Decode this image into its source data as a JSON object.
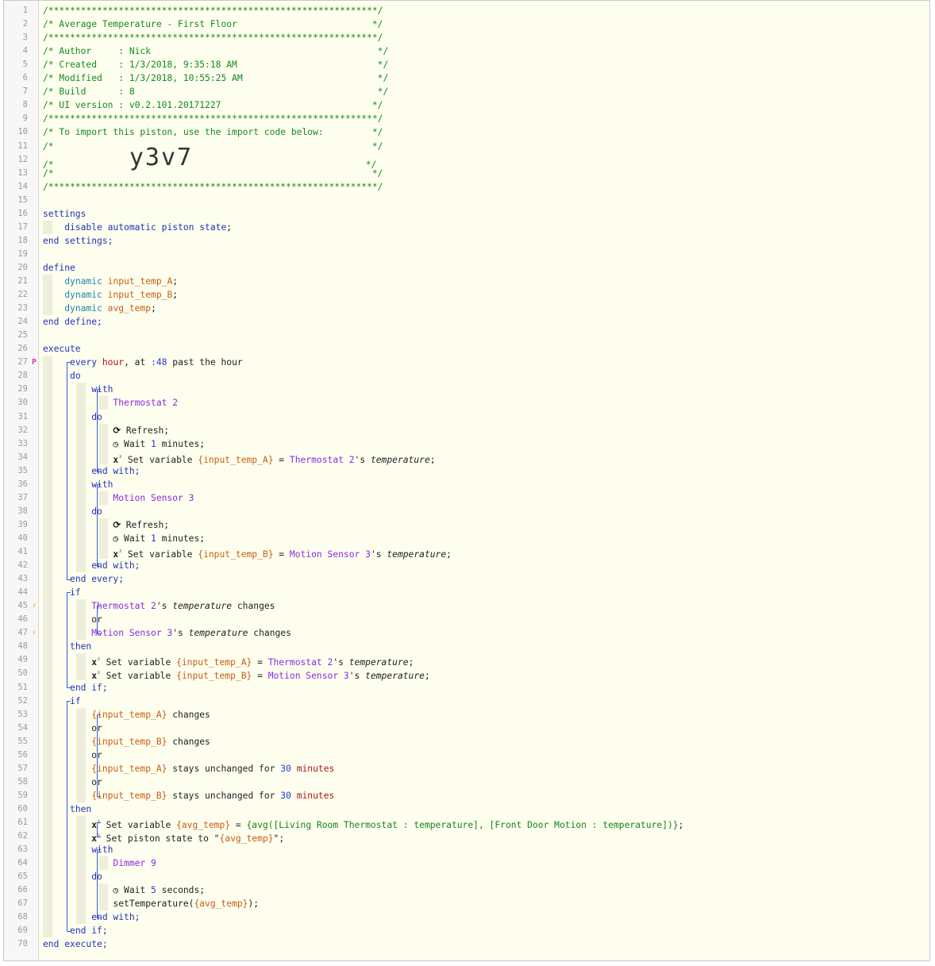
{
  "import_code": "y3v7",
  "lines": [
    {
      "n": "1",
      "marker": "",
      "segs": [
        {
          "t": "/*************************************************************/",
          "c": "c"
        }
      ]
    },
    {
      "n": "2",
      "marker": "",
      "segs": [
        {
          "t": "/* Average Temperature - First Floor                         */",
          "c": "c"
        }
      ]
    },
    {
      "n": "3",
      "marker": "",
      "segs": [
        {
          "t": "/*************************************************************/",
          "c": "c"
        }
      ]
    },
    {
      "n": "4",
      "marker": "",
      "segs": [
        {
          "t": "/* Author     : Nick                                          */",
          "c": "c"
        }
      ]
    },
    {
      "n": "5",
      "marker": "",
      "segs": [
        {
          "t": "/* Created    : 1/3/2018, 9:35:18 AM                          */",
          "c": "c"
        }
      ]
    },
    {
      "n": "6",
      "marker": "",
      "segs": [
        {
          "t": "/* Modified   : 1/3/2018, 10:55:25 AM                         */",
          "c": "c"
        }
      ]
    },
    {
      "n": "7",
      "marker": "",
      "segs": [
        {
          "t": "/* Build      : 8                                             */",
          "c": "c"
        }
      ]
    },
    {
      "n": "8",
      "marker": "",
      "segs": [
        {
          "t": "/* UI version : v0.2.101.20171227                            */",
          "c": "c"
        }
      ]
    },
    {
      "n": "9",
      "marker": "",
      "segs": [
        {
          "t": "/*************************************************************/",
          "c": "c"
        }
      ]
    },
    {
      "n": "10",
      "marker": "",
      "segs": [
        {
          "t": "/* To import this piston, use the import code below:         */",
          "c": "c"
        }
      ]
    },
    {
      "n": "11",
      "marker": "",
      "segs": [
        {
          "t": "/*                                                           */",
          "c": "c"
        }
      ]
    },
    {
      "n": "12",
      "marker": "",
      "segs": [
        {
          "t": "/*              ",
          "c": "c"
        },
        {
          "t": "y3v7",
          "c": "bigcode"
        },
        {
          "t": "                                */",
          "c": "c"
        }
      ]
    },
    {
      "n": "13",
      "marker": "",
      "segs": [
        {
          "t": "/*                                                           */",
          "c": "c"
        }
      ]
    },
    {
      "n": "14",
      "marker": "",
      "segs": [
        {
          "t": "/*************************************************************/",
          "c": "c"
        }
      ]
    },
    {
      "n": "15",
      "marker": "",
      "segs": []
    },
    {
      "n": "16",
      "marker": "",
      "segs": [
        {
          "t": "settings",
          "c": "k"
        }
      ]
    },
    {
      "n": "17",
      "marker": "",
      "segs": [
        {
          "t": "    "
        },
        {
          "t": "disable automatic piston state",
          "c": "k"
        },
        {
          "t": ";"
        }
      ]
    },
    {
      "n": "18",
      "marker": "",
      "segs": [
        {
          "t": "end settings;",
          "c": "k"
        }
      ]
    },
    {
      "n": "19",
      "marker": "",
      "segs": []
    },
    {
      "n": "20",
      "marker": "",
      "segs": [
        {
          "t": "define",
          "c": "k"
        }
      ]
    },
    {
      "n": "21",
      "marker": "",
      "segs": [
        {
          "t": "    "
        },
        {
          "t": "dynamic",
          "c": "t"
        },
        {
          "t": " "
        },
        {
          "t": "input_temp_A",
          "c": "v"
        },
        {
          "t": ";"
        }
      ]
    },
    {
      "n": "22",
      "marker": "",
      "segs": [
        {
          "t": "    "
        },
        {
          "t": "dynamic",
          "c": "t"
        },
        {
          "t": " "
        },
        {
          "t": "input_temp_B",
          "c": "v"
        },
        {
          "t": ";"
        }
      ]
    },
    {
      "n": "23",
      "marker": "",
      "segs": [
        {
          "t": "    "
        },
        {
          "t": "dynamic",
          "c": "t"
        },
        {
          "t": " "
        },
        {
          "t": "avg_temp",
          "c": "v"
        },
        {
          "t": ";"
        }
      ]
    },
    {
      "n": "24",
      "marker": "",
      "segs": [
        {
          "t": "end define;",
          "c": "k"
        }
      ]
    },
    {
      "n": "25",
      "marker": "",
      "segs": []
    },
    {
      "n": "26",
      "marker": "",
      "segs": [
        {
          "t": "execute",
          "c": "k"
        }
      ]
    },
    {
      "n": "27",
      "marker": "flag",
      "segs": [
        {
          "t": "     "
        },
        {
          "t": "every",
          "c": "k"
        },
        {
          "t": " "
        },
        {
          "t": "hour",
          "c": "r"
        },
        {
          "t": ", at "
        },
        {
          "t": ":48",
          "c": "n"
        },
        {
          "t": " past the hour"
        }
      ]
    },
    {
      "n": "28",
      "marker": "",
      "segs": [
        {
          "t": "     "
        },
        {
          "t": "do",
          "c": "k"
        }
      ]
    },
    {
      "n": "29",
      "marker": "",
      "segs": [
        {
          "t": "         "
        },
        {
          "t": "with",
          "c": "k"
        }
      ]
    },
    {
      "n": "30",
      "marker": "",
      "segs": [
        {
          "t": "             "
        },
        {
          "t": "Thermostat 2",
          "c": "d"
        }
      ]
    },
    {
      "n": "31",
      "marker": "",
      "segs": [
        {
          "t": "         "
        },
        {
          "t": "do",
          "c": "k"
        }
      ]
    },
    {
      "n": "32",
      "marker": "",
      "segs": [
        {
          "t": "             "
        },
        {
          "t": "⟳",
          "c": "icon"
        },
        {
          "t": " Refresh;"
        }
      ]
    },
    {
      "n": "33",
      "marker": "",
      "segs": [
        {
          "t": "             "
        },
        {
          "t": "◷",
          "c": "icon"
        },
        {
          "t": " Wait "
        },
        {
          "t": "1",
          "c": "n"
        },
        {
          "t": " minutes;"
        }
      ]
    },
    {
      "n": "34",
      "marker": "",
      "segs": [
        {
          "t": "             "
        },
        {
          "t": "x",
          "c": "icon"
        },
        {
          "t": "²",
          "c": "sup"
        },
        {
          "t": " Set variable "
        },
        {
          "t": "{input_temp_A}",
          "c": "v"
        },
        {
          "t": " = "
        },
        {
          "t": "Thermostat 2",
          "c": "d"
        },
        {
          "t": "'s "
        },
        {
          "t": "temperature",
          "c": "it"
        },
        {
          "t": ";"
        }
      ]
    },
    {
      "n": "35",
      "marker": "",
      "segs": [
        {
          "t": "         "
        },
        {
          "t": "end with;",
          "c": "k"
        }
      ]
    },
    {
      "n": "36",
      "marker": "",
      "segs": [
        {
          "t": "         "
        },
        {
          "t": "with",
          "c": "k"
        }
      ]
    },
    {
      "n": "37",
      "marker": "",
      "segs": [
        {
          "t": "             "
        },
        {
          "t": "Motion Sensor 3",
          "c": "d"
        }
      ]
    },
    {
      "n": "38",
      "marker": "",
      "segs": [
        {
          "t": "         "
        },
        {
          "t": "do",
          "c": "k"
        }
      ]
    },
    {
      "n": "39",
      "marker": "",
      "segs": [
        {
          "t": "             "
        },
        {
          "t": "⟳",
          "c": "icon"
        },
        {
          "t": " Refresh;"
        }
      ]
    },
    {
      "n": "40",
      "marker": "",
      "segs": [
        {
          "t": "             "
        },
        {
          "t": "◷",
          "c": "icon"
        },
        {
          "t": " Wait "
        },
        {
          "t": "1",
          "c": "n"
        },
        {
          "t": " minutes;"
        }
      ]
    },
    {
      "n": "41",
      "marker": "",
      "segs": [
        {
          "t": "             "
        },
        {
          "t": "x",
          "c": "icon"
        },
        {
          "t": "²",
          "c": "sup"
        },
        {
          "t": " Set variable "
        },
        {
          "t": "{input_temp_B}",
          "c": "v"
        },
        {
          "t": " = "
        },
        {
          "t": "Motion Sensor 3",
          "c": "d"
        },
        {
          "t": "'s "
        },
        {
          "t": "temperature",
          "c": "it"
        },
        {
          "t": ";"
        }
      ]
    },
    {
      "n": "42",
      "marker": "",
      "segs": [
        {
          "t": "         "
        },
        {
          "t": "end with;",
          "c": "k"
        }
      ]
    },
    {
      "n": "43",
      "marker": "",
      "segs": [
        {
          "t": "     "
        },
        {
          "t": "end every;",
          "c": "k"
        }
      ]
    },
    {
      "n": "44",
      "marker": "",
      "segs": [
        {
          "t": "     "
        },
        {
          "t": "if",
          "c": "k"
        }
      ]
    },
    {
      "n": "45",
      "marker": "bolt",
      "segs": [
        {
          "t": "         "
        },
        {
          "t": "Thermostat 2",
          "c": "d"
        },
        {
          "t": "'s "
        },
        {
          "t": "temperature",
          "c": "it"
        },
        {
          "t": " changes"
        }
      ]
    },
    {
      "n": "46",
      "marker": "",
      "segs": [
        {
          "t": "         or"
        }
      ]
    },
    {
      "n": "47",
      "marker": "bolt",
      "segs": [
        {
          "t": "         "
        },
        {
          "t": "Motion Sensor 3",
          "c": "d"
        },
        {
          "t": "'s "
        },
        {
          "t": "temperature",
          "c": "it"
        },
        {
          "t": " changes"
        }
      ]
    },
    {
      "n": "48",
      "marker": "",
      "segs": [
        {
          "t": "     "
        },
        {
          "t": "then",
          "c": "k"
        }
      ]
    },
    {
      "n": "49",
      "marker": "",
      "segs": [
        {
          "t": "         "
        },
        {
          "t": "x",
          "c": "icon"
        },
        {
          "t": "²",
          "c": "sup"
        },
        {
          "t": " Set variable "
        },
        {
          "t": "{input_temp_A}",
          "c": "v"
        },
        {
          "t": " = "
        },
        {
          "t": "Thermostat 2",
          "c": "d"
        },
        {
          "t": "'s "
        },
        {
          "t": "temperature",
          "c": "it"
        },
        {
          "t": ";"
        }
      ]
    },
    {
      "n": "50",
      "marker": "",
      "segs": [
        {
          "t": "         "
        },
        {
          "t": "x",
          "c": "icon"
        },
        {
          "t": "²",
          "c": "sup"
        },
        {
          "t": " Set variable "
        },
        {
          "t": "{input_temp_B}",
          "c": "v"
        },
        {
          "t": " = "
        },
        {
          "t": "Motion Sensor 3",
          "c": "d"
        },
        {
          "t": "'s "
        },
        {
          "t": "temperature",
          "c": "it"
        },
        {
          "t": ";"
        }
      ]
    },
    {
      "n": "51",
      "marker": "",
      "segs": [
        {
          "t": "     "
        },
        {
          "t": "end if;",
          "c": "k"
        }
      ]
    },
    {
      "n": "52",
      "marker": "",
      "segs": [
        {
          "t": "     "
        },
        {
          "t": "if",
          "c": "k"
        }
      ]
    },
    {
      "n": "53",
      "marker": "",
      "segs": [
        {
          "t": "         "
        },
        {
          "t": "{input_temp_A}",
          "c": "v"
        },
        {
          "t": " changes"
        }
      ]
    },
    {
      "n": "54",
      "marker": "",
      "segs": [
        {
          "t": "         or"
        }
      ]
    },
    {
      "n": "55",
      "marker": "",
      "segs": [
        {
          "t": "         "
        },
        {
          "t": "{input_temp_B}",
          "c": "v"
        },
        {
          "t": " changes"
        }
      ]
    },
    {
      "n": "56",
      "marker": "",
      "segs": [
        {
          "t": "         or"
        }
      ]
    },
    {
      "n": "57",
      "marker": "",
      "segs": [
        {
          "t": "         "
        },
        {
          "t": "{input_temp_A}",
          "c": "v"
        },
        {
          "t": " stays unchanged for "
        },
        {
          "t": "30",
          "c": "n"
        },
        {
          "t": " "
        },
        {
          "t": "minutes",
          "c": "r"
        }
      ]
    },
    {
      "n": "58",
      "marker": "",
      "segs": [
        {
          "t": "         or"
        }
      ]
    },
    {
      "n": "59",
      "marker": "",
      "segs": [
        {
          "t": "         "
        },
        {
          "t": "{input_temp_B}",
          "c": "v"
        },
        {
          "t": " stays unchanged for "
        },
        {
          "t": "30",
          "c": "n"
        },
        {
          "t": " "
        },
        {
          "t": "minutes",
          "c": "r"
        }
      ]
    },
    {
      "n": "60",
      "marker": "",
      "segs": [
        {
          "t": "     "
        },
        {
          "t": "then",
          "c": "k"
        }
      ]
    },
    {
      "n": "61",
      "marker": "",
      "segs": [
        {
          "t": "         "
        },
        {
          "t": "x",
          "c": "icon"
        },
        {
          "t": "²",
          "c": "sup"
        },
        {
          "t": " Set variable "
        },
        {
          "t": "{avg_temp}",
          "c": "v"
        },
        {
          "t": " = "
        },
        {
          "t": "{avg([Living Room Thermostat : temperature], [Front Door Motion : temperature])}",
          "c": "g"
        },
        {
          "t": ";"
        }
      ]
    },
    {
      "n": "62",
      "marker": "",
      "segs": [
        {
          "t": "         "
        },
        {
          "t": "x",
          "c": "icon"
        },
        {
          "t": "²",
          "c": "sup"
        },
        {
          "t": " Set piston state to \""
        },
        {
          "t": "{avg_temp}",
          "c": "v"
        },
        {
          "t": "\";"
        }
      ]
    },
    {
      "n": "63",
      "marker": "",
      "segs": [
        {
          "t": "         "
        },
        {
          "t": "with",
          "c": "k"
        }
      ]
    },
    {
      "n": "64",
      "marker": "",
      "segs": [
        {
          "t": "             "
        },
        {
          "t": "Dimmer 9",
          "c": "d"
        }
      ]
    },
    {
      "n": "65",
      "marker": "",
      "segs": [
        {
          "t": "         "
        },
        {
          "t": "do",
          "c": "k"
        }
      ]
    },
    {
      "n": "66",
      "marker": "",
      "segs": [
        {
          "t": "             "
        },
        {
          "t": "◷",
          "c": "icon"
        },
        {
          "t": " Wait "
        },
        {
          "t": "5",
          "c": "n"
        },
        {
          "t": " seconds;"
        }
      ]
    },
    {
      "n": "67",
      "marker": "",
      "segs": [
        {
          "t": "             setTemperature("
        },
        {
          "t": "{avg_temp}",
          "c": "v"
        },
        {
          "t": ");"
        }
      ]
    },
    {
      "n": "68",
      "marker": "",
      "segs": [
        {
          "t": "         "
        },
        {
          "t": "end with;",
          "c": "k"
        }
      ]
    },
    {
      "n": "69",
      "marker": "",
      "segs": [
        {
          "t": "     "
        },
        {
          "t": "end if;",
          "c": "k"
        }
      ]
    },
    {
      "n": "70",
      "marker": "",
      "segs": [
        {
          "t": "end execute;",
          "c": "k"
        }
      ]
    }
  ]
}
